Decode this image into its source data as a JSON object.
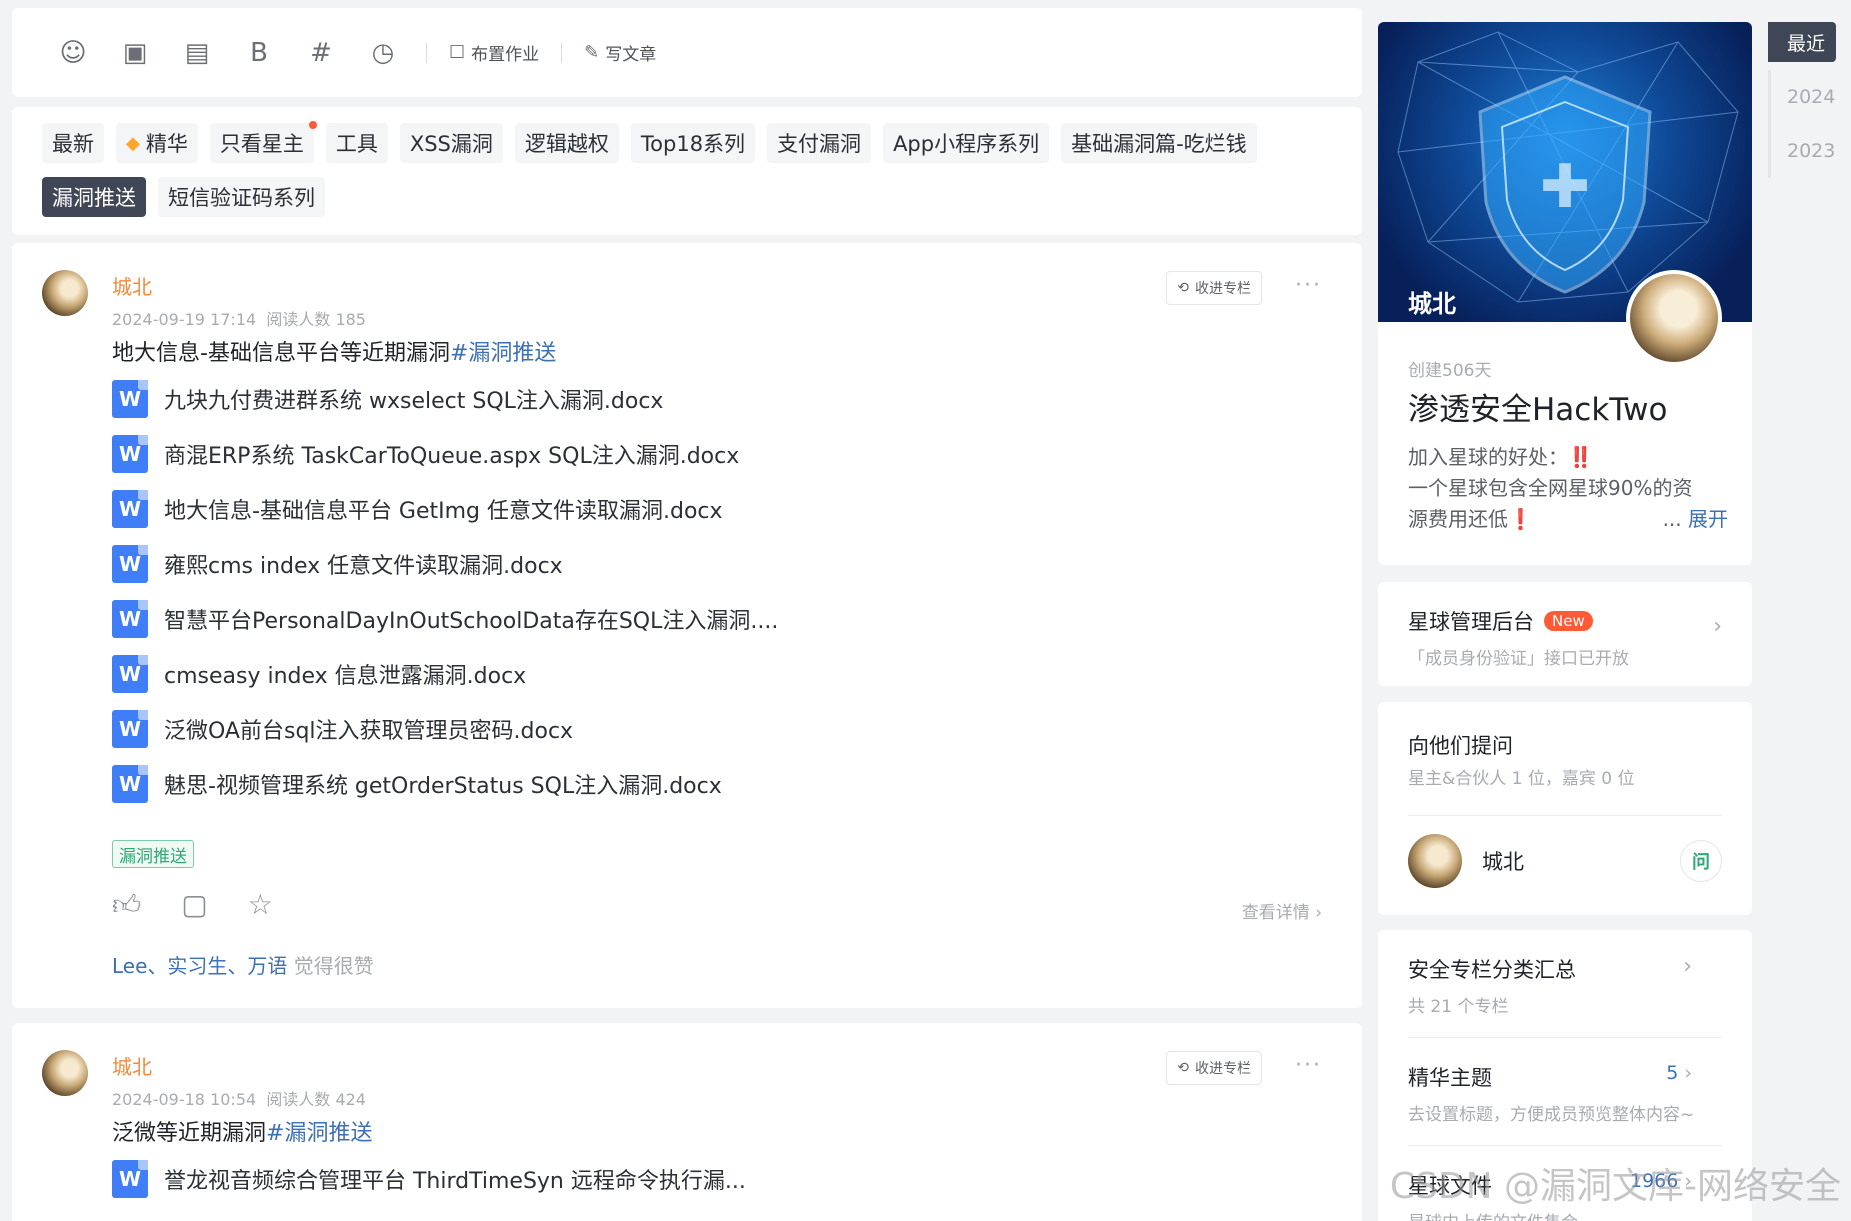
{
  "toolbar": {
    "assign_homework": "布置作业",
    "write_article": "写文章"
  },
  "tags": [
    {
      "label": "最新",
      "active": false
    },
    {
      "label": "精华",
      "active": false
    },
    {
      "label": "只看星主",
      "active": false
    },
    {
      "label": "工具",
      "active": false
    },
    {
      "label": "XSS漏洞",
      "active": false
    },
    {
      "label": "逻辑越权",
      "active": false
    },
    {
      "label": "Top18系列",
      "active": false
    },
    {
      "label": "支付漏洞",
      "active": false
    },
    {
      "label": "App小程序系列",
      "active": false
    },
    {
      "label": "基础漏洞篇-吃烂钱",
      "active": false
    },
    {
      "label": "漏洞推送",
      "active": true
    },
    {
      "label": "短信验证码系列",
      "active": false
    }
  ],
  "post1": {
    "author": "城北",
    "date": "2024-09-19 17:14",
    "reads": "阅读人数 185",
    "collect_label": "收进专栏",
    "title": "地大信息-基础信息平台等近期漏洞",
    "hashtag": "#漏洞推送",
    "files": [
      "九块九付费进群系统 wxselect SQL注入漏洞.docx",
      "商混ERP系统 TaskCarToQueue.aspx SQL注入漏洞.docx",
      "地大信息-基础信息平台 GetImg 任意文件读取漏洞.docx",
      "雍熙cms index 任意文件读取漏洞.docx",
      "智慧平台PersonalDayInOutSchoolData存在SQL注入漏洞....",
      "cmseasy index 信息泄露漏洞.docx",
      "泛微OA前台sql注入获取管理员密码.docx",
      "魅思-视频管理系统 getOrderStatus SQL注入漏洞.docx"
    ],
    "topic": "漏洞推送",
    "detail_link": "查看详情",
    "likers": "Lee、实习生、万语",
    "likes_suffix": " 觉得很赞"
  },
  "post2": {
    "author": "城北",
    "date": "2024-09-18 10:54",
    "reads": "阅读人数 424",
    "collect_label": "收进专栏",
    "title": "泛微等近期漏洞",
    "hashtag": "#漏洞推送",
    "files": [
      "誉龙视音频综合管理平台 ThirdTimeSyn 远程命令执行漏..."
    ]
  },
  "profile": {
    "banner_name": "城北",
    "days": "创建506天",
    "group_name": "渗透安全HackTwo",
    "intro_line1": "加入星球的好处：‼️",
    "intro_line2": "一个星球包含全网星球90%的资",
    "intro_line3": "源费用还低",
    "excl": "❗",
    "expand": "展开",
    "ellipsis": "..."
  },
  "admin": {
    "title": "星球管理后台",
    "badge": "New",
    "sub": "「成员身份验证」接口已开放"
  },
  "ask": {
    "title": "向他们提问",
    "sub": "星主&合伙人 1 位，嘉宾 0 位",
    "host": "城北",
    "ask_label": "问"
  },
  "columns": {
    "c1_title": "安全专栏分类汇总",
    "c1_sub": "共 21 个专栏",
    "c2_title": "精华主题",
    "c2_sub": "去设置标题，方便成员预览整体内容~",
    "c2_count": "5",
    "c3_title": "星球文件",
    "c3_sub": "星球内上传的文件集合",
    "c3_count": "1966"
  },
  "timeline": [
    "最近",
    "2024",
    "2023"
  ],
  "watermark": "CSDN @漏洞文库-网络安全",
  "colors": {
    "accent_orange": "#f28a3c",
    "link_blue": "#3d6fb6",
    "dark_tag": "#3f4655",
    "badge_red": "#ff5a36"
  }
}
